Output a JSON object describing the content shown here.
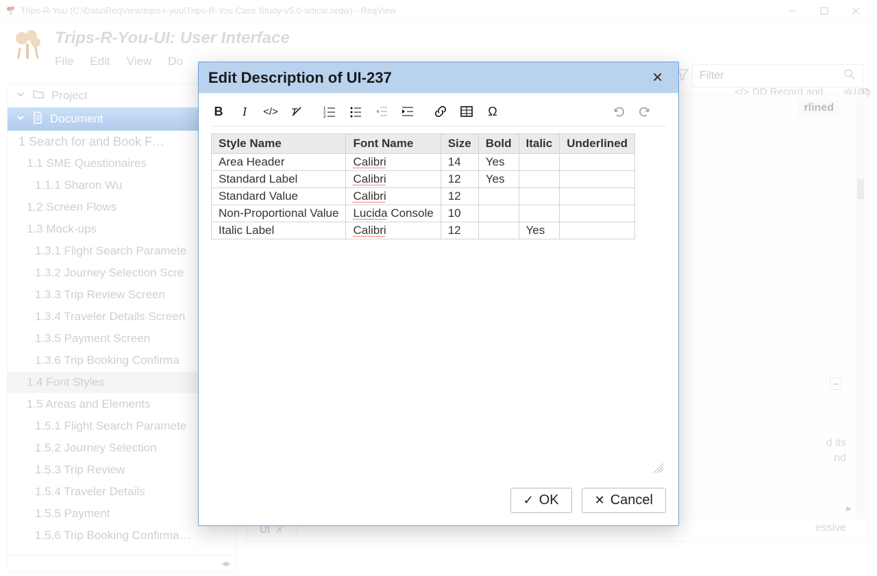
{
  "window": {
    "title": "Trips-R-You (C:\\Data\\ReqView\\trips-r-you\\Trips-R-You Case Study-v5.0-article.reqw) - ReqView"
  },
  "header": {
    "doc_title": "Trips-R-You-UI: User Interface",
    "menu": [
      "File",
      "Edit",
      "View",
      "Do"
    ],
    "filter_placeholder": "Filter"
  },
  "sidebar": {
    "project_label": "Project",
    "document_label": "Document",
    "items": [
      {
        "lvl": "l1",
        "label": "1 Search for and Book F…"
      },
      {
        "lvl": "l2",
        "label": "1.1 SME Questionaires"
      },
      {
        "lvl": "l3",
        "label": "1.1.1 Sharon Wu"
      },
      {
        "lvl": "l2",
        "label": "1.2 Screen Flows"
      },
      {
        "lvl": "l2",
        "label": "1.3 Mock-ups"
      },
      {
        "lvl": "l3",
        "label": "1.3.1 Flight Search Paramete"
      },
      {
        "lvl": "l3",
        "label": "1.3.2 Journey Selection Scre"
      },
      {
        "lvl": "l3",
        "label": "1.3.3 Trip Review Screen"
      },
      {
        "lvl": "l3",
        "label": "1.3.4 Traveler Details Screen"
      },
      {
        "lvl": "l3",
        "label": "1.3.5 Payment Screen"
      },
      {
        "lvl": "l3",
        "label": "1.3.6 Trip Booking Confirma"
      },
      {
        "lvl": "l2",
        "label": "1.4 Font Styles",
        "selected": true
      },
      {
        "lvl": "l2",
        "label": "1.5 Areas and Elements"
      },
      {
        "lvl": "l3",
        "label": "1.5.1 Flight Search Paramete"
      },
      {
        "lvl": "l3",
        "label": "1.5.2 Journey Selection"
      },
      {
        "lvl": "l3",
        "label": "1.5.3 Trip Review"
      },
      {
        "lvl": "l3",
        "label": "1.5.4 Traveler Details"
      },
      {
        "lvl": "l3",
        "label": "1.5.5 Payment"
      },
      {
        "lvl": "l3",
        "label": "1.5.6 Trip Booking Confirma…"
      }
    ]
  },
  "rightpanel": {
    "head_label": "DD Record and Field",
    "label_tab": "Lab",
    "bg_col_header": "rlined",
    "bg_word1": "d its",
    "bg_word2": "nd",
    "bg_word3": "essive",
    "tab_label": "UI"
  },
  "dialog": {
    "title": "Edit Description of UI-237",
    "ok_label": "OK",
    "cancel_label": "Cancel",
    "table": {
      "headers": [
        "Style Name",
        "Font Name",
        "Size",
        "Bold",
        "Italic",
        "Underlined"
      ],
      "rows": [
        {
          "style": "Area Header",
          "font": "Calibri",
          "size": "14",
          "bold": "Yes",
          "italic": "",
          "under": ""
        },
        {
          "style": "Standard Label",
          "font": "Calibri",
          "size": "12",
          "bold": "Yes",
          "italic": "",
          "under": ""
        },
        {
          "style": "Standard Value",
          "font": "Calibri",
          "size": "12",
          "bold": "",
          "italic": "",
          "under": ""
        },
        {
          "style": "Non-Proportional Value",
          "font": "Lucida Console",
          "size": "10",
          "bold": "",
          "italic": "",
          "under": ""
        },
        {
          "style": "Italic Label",
          "font": "Calibri",
          "size": "12",
          "bold": "",
          "italic": "Yes",
          "under": ""
        }
      ]
    }
  }
}
